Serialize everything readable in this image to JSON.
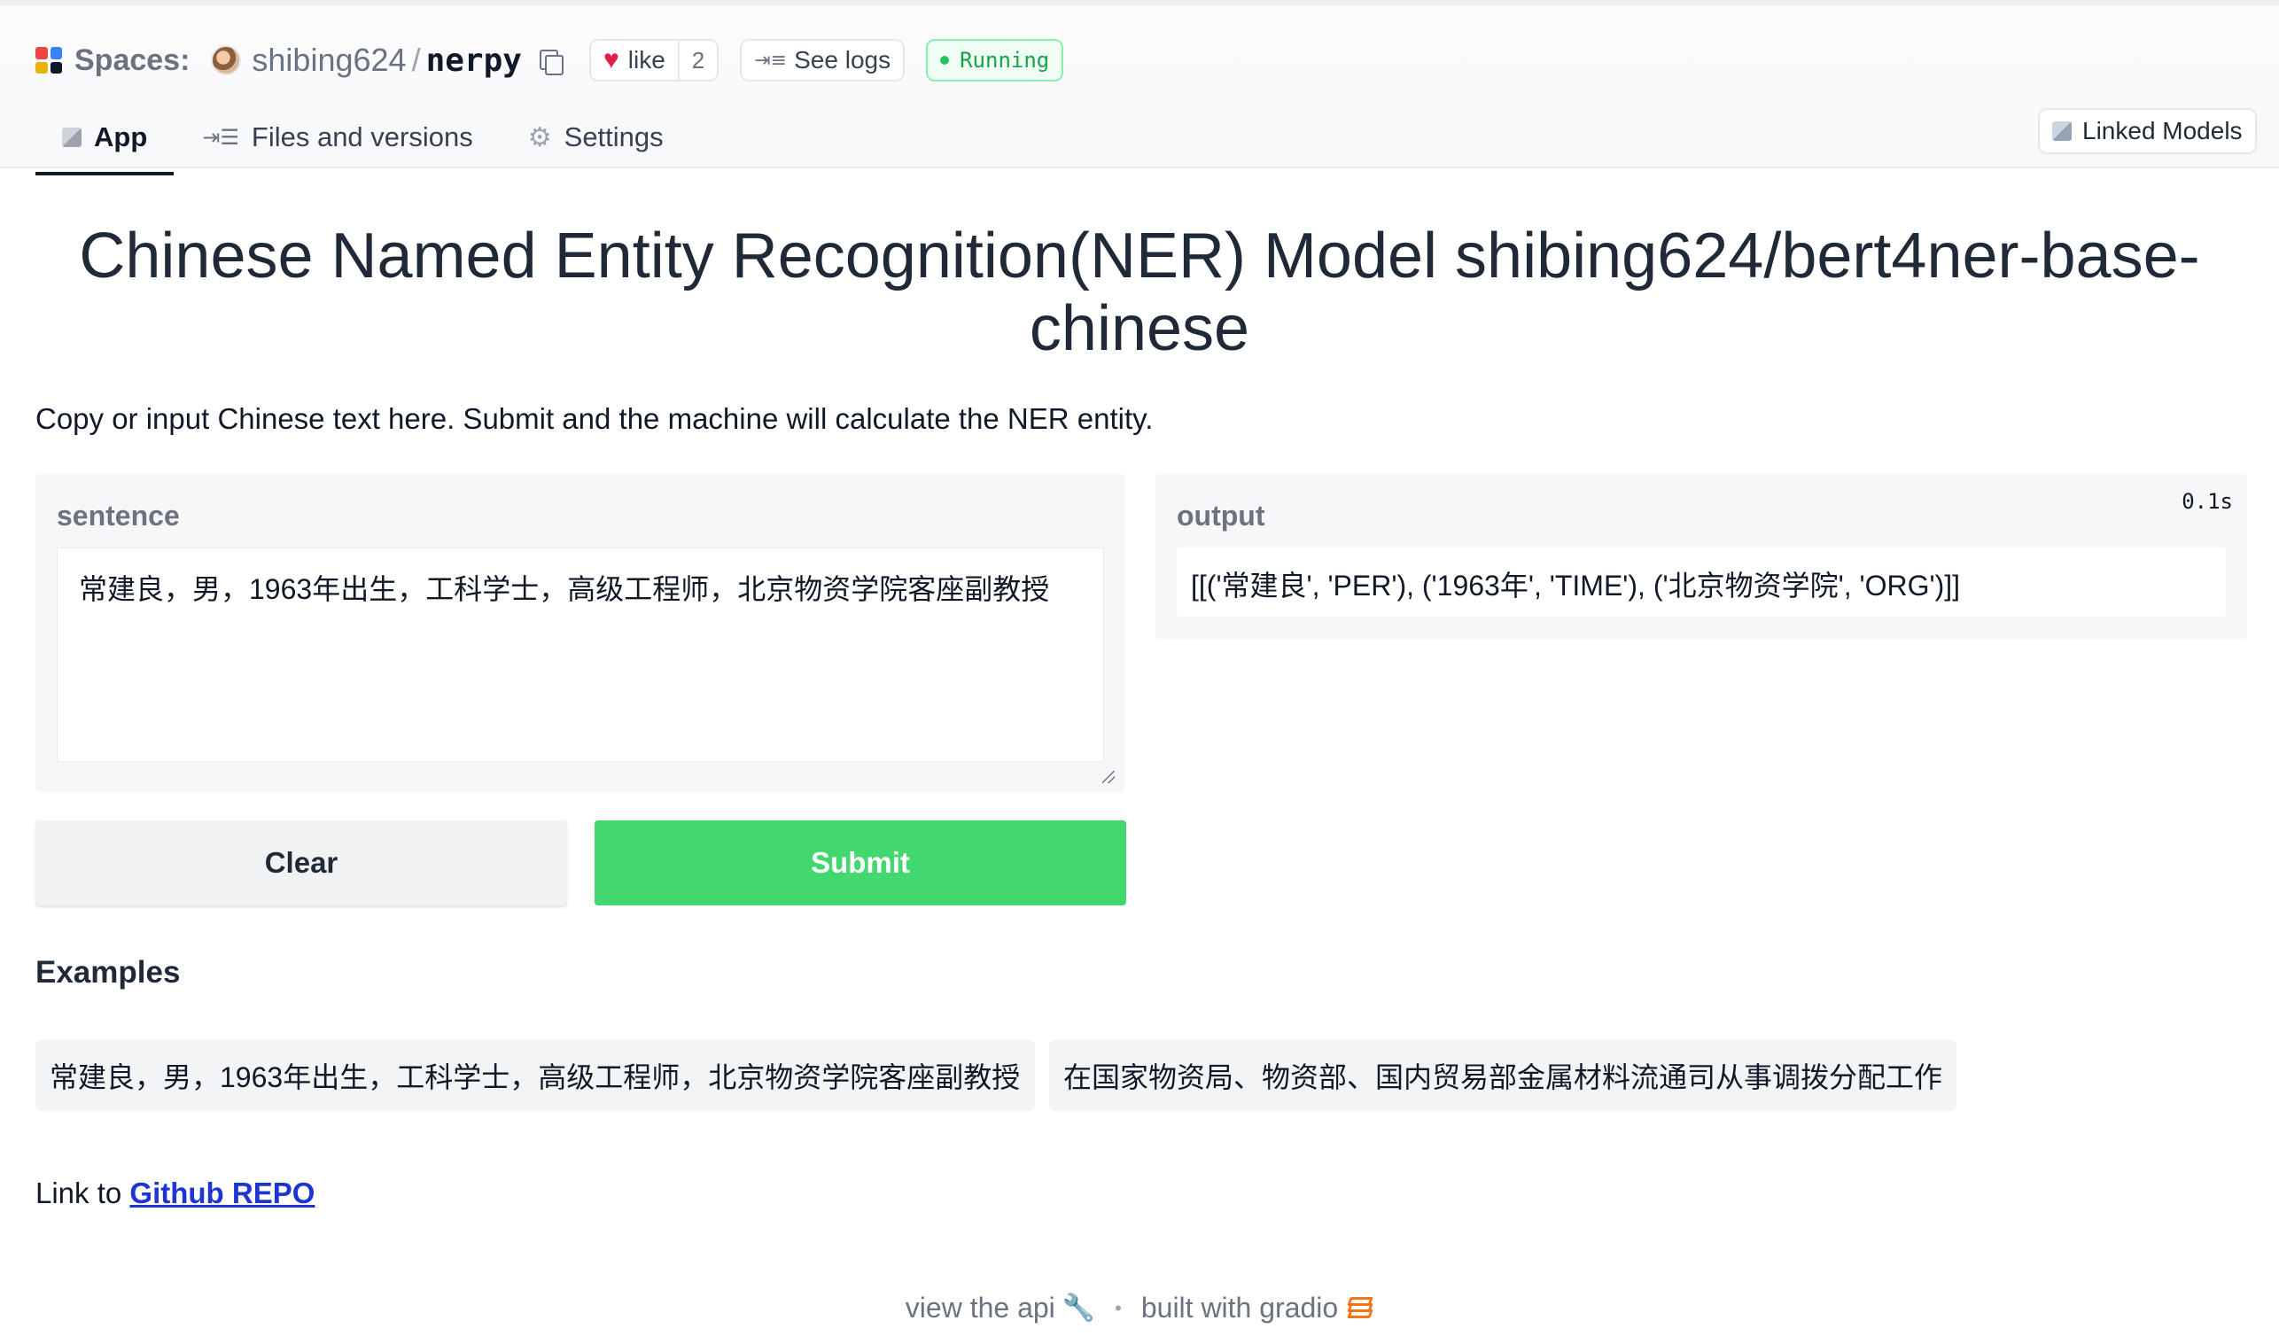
{
  "header": {
    "spaces_label": "Spaces:",
    "owner": "shibing624",
    "repo": "nerpy",
    "like_label": "like",
    "like_count": "2",
    "logs_label": "See logs",
    "status": "Running",
    "status_color": "#16a34a",
    "tabs": [
      {
        "label": "App",
        "icon": "cube-icon",
        "active": true
      },
      {
        "label": "Files and versions",
        "icon": "files-icon",
        "active": false
      },
      {
        "label": "Settings",
        "icon": "gear-icon",
        "active": false
      }
    ],
    "linked_models_label": "Linked Models"
  },
  "app": {
    "title": "Chinese Named Entity Recognition(NER) Model shibing624/bert4ner-base-chinese",
    "description": "Copy or input Chinese text here. Submit and the machine will calculate the NER entity.",
    "input": {
      "label": "sentence",
      "value": "常建良，男，1963年出生，工科学士，高级工程师，北京物资学院客座副教授"
    },
    "output": {
      "label": "output",
      "timer": "0.1s",
      "value": "[[('常建良', 'PER'), ('1963年', 'TIME'), ('北京物资学院', 'ORG')]]"
    },
    "buttons": {
      "clear": "Clear",
      "submit": "Submit",
      "submit_color": "#43d86f"
    },
    "examples": {
      "title": "Examples",
      "items": [
        "常建良，男，1963年出生，工科学士，高级工程师，北京物资学院客座副教授",
        "在国家物资局、物资部、国内贸易部金属材料流通司从事调拨分配工作"
      ]
    },
    "link": {
      "prefix": "Link to ",
      "text": "Github REPO"
    }
  },
  "footer": {
    "api_label": "view the api",
    "separator": "•",
    "built_label": "built with gradio"
  }
}
